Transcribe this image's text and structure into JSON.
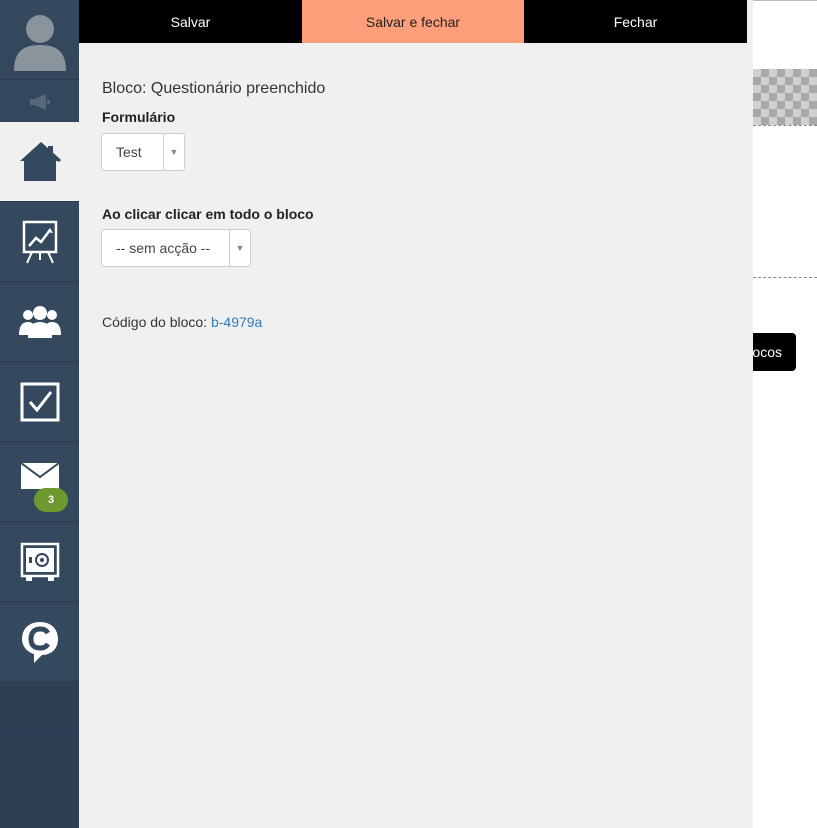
{
  "toolbar": {
    "save_label": "Salvar",
    "save_close_label": "Salvar e fechar",
    "close_label": "Fechar"
  },
  "block": {
    "title": "Bloco: Questionário preenchido",
    "form_label": "Formulário",
    "form_value": "Test",
    "click_label": "Ao clicar clicar em todo o bloco",
    "click_value": "-- sem acção --",
    "code_label": "Código do bloco:",
    "code_value": "b-4979a"
  },
  "sidebar": {
    "messages_badge": "3"
  },
  "background": {
    "button_partial_label": "ocos"
  },
  "colors": {
    "sidebar": "#34495e",
    "accent_button": "#ff9e7a",
    "badge": "#6d9a2e",
    "link": "#337ab7"
  }
}
